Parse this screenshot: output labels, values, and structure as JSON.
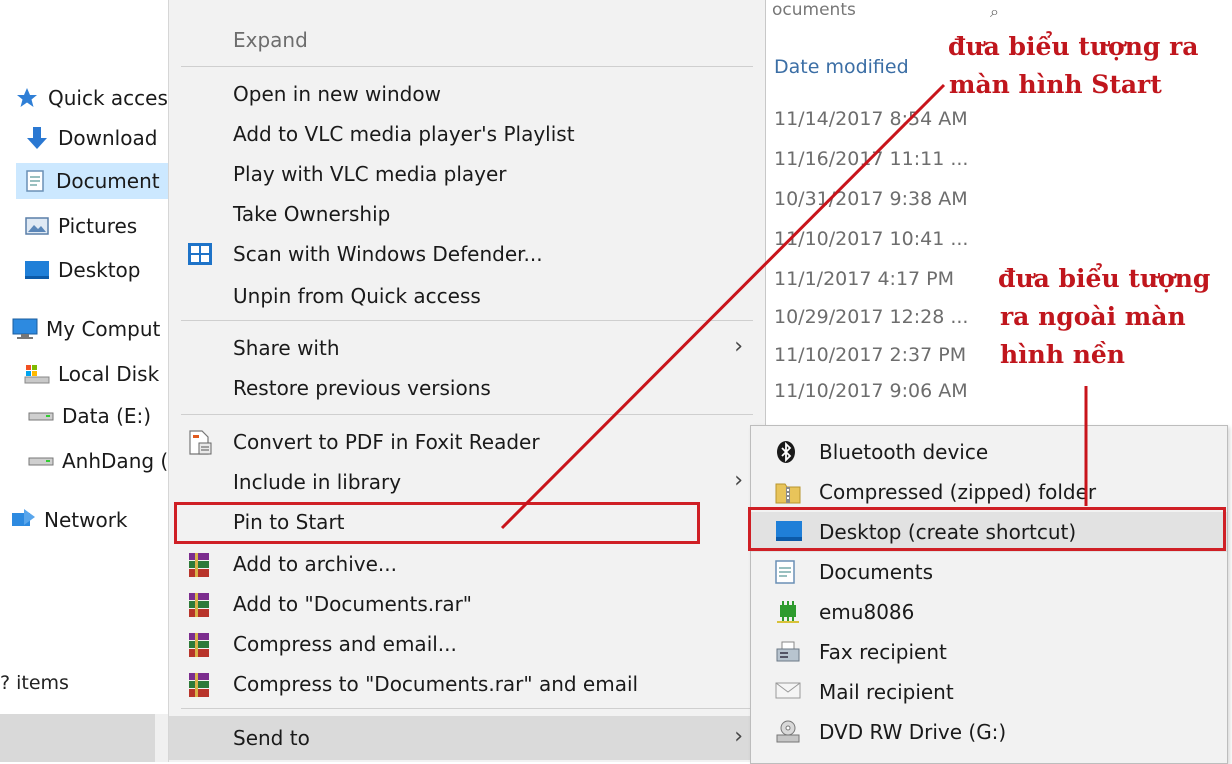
{
  "nav": {
    "items": [
      {
        "label": "Quick acces",
        "icon": "star-icon"
      },
      {
        "label": "Download",
        "icon": "download-arrow-icon"
      },
      {
        "label": "Document",
        "icon": "documents-icon"
      },
      {
        "label": "Pictures",
        "icon": "pictures-icon"
      },
      {
        "label": "Desktop",
        "icon": "desktop-icon"
      },
      {
        "label": "My Comput",
        "icon": "computer-icon"
      },
      {
        "label": "Local Disk",
        "icon": "local-disk-icon"
      },
      {
        "label": "Data (E:)",
        "icon": "drive-icon"
      },
      {
        "label": "AnhDang (",
        "icon": "drive-icon"
      },
      {
        "label": "Network",
        "icon": "network-icon"
      }
    ],
    "status": "? items"
  },
  "filelist": {
    "search_fragment": "ocuments",
    "column_header": "Date modified",
    "dates": [
      "11/14/2017 8:54 AM",
      "11/16/2017 11:11 ...",
      "10/31/2017 9:38 AM",
      "11/10/2017 10:41 ...",
      "11/1/2017 4:17 PM",
      "10/29/2017 12:28 ...",
      "11/10/2017 2:37 PM",
      "11/10/2017 9:06 AM"
    ]
  },
  "context_menu": {
    "items": [
      {
        "label": "Expand"
      },
      {
        "label": "Open in new window"
      },
      {
        "label": "Add to VLC media player's Playlist"
      },
      {
        "label": "Play with VLC media player"
      },
      {
        "label": "Take Ownership"
      },
      {
        "label": "Scan with Windows Defender..."
      },
      {
        "label": "Unpin from Quick access"
      },
      {
        "label": "Share with"
      },
      {
        "label": "Restore previous versions"
      },
      {
        "label": "Convert to PDF in Foxit Reader"
      },
      {
        "label": "Include in library"
      },
      {
        "label": "Pin to Start"
      },
      {
        "label": "Add to archive..."
      },
      {
        "label": "Add to \"Documents.rar\""
      },
      {
        "label": "Compress and email..."
      },
      {
        "label": "Compress to \"Documents.rar\" and email"
      },
      {
        "label": "Send to"
      }
    ]
  },
  "send_to": {
    "items": [
      {
        "label": "Bluetooth device",
        "icon": "bluetooth-icon"
      },
      {
        "label": "Compressed (zipped) folder",
        "icon": "zip-folder-icon"
      },
      {
        "label": "Desktop (create shortcut)",
        "icon": "desktop-icon"
      },
      {
        "label": "Documents",
        "icon": "documents-icon"
      },
      {
        "label": "emu8086",
        "icon": "chip-icon"
      },
      {
        "label": "Fax recipient",
        "icon": "fax-icon"
      },
      {
        "label": "Mail recipient",
        "icon": "mail-icon"
      },
      {
        "label": "DVD RW Drive (G:)",
        "icon": "dvd-drive-icon"
      }
    ]
  },
  "annotations": {
    "start_line1": "đưa biểu tượng ra",
    "start_line2": "màn hình Start",
    "desktop_line1": "đưa biểu tượng",
    "desktop_line2": "ra ngoài màn",
    "desktop_line3": "hình nền"
  },
  "colors": {
    "annotation_red": "#c0161d",
    "selection_blue": "#cce8ff",
    "menu_bg": "#f2f2f2"
  }
}
